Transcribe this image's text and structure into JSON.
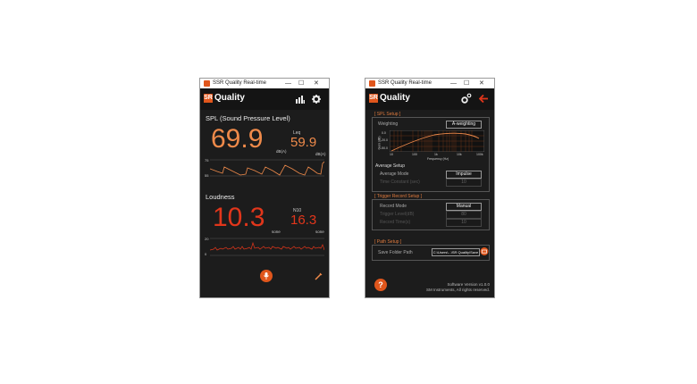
{
  "window_title": "SSR Quality Real-time",
  "logo": {
    "badge": "SR",
    "text": "Quality"
  },
  "left": {
    "spl_title": "SPL (Sound Pressure Level)",
    "spl_value": "69.9",
    "spl_unit": "dB(A)",
    "leq_label": "Leq",
    "leq_value": "59.9",
    "leq_unit": "dB(A)",
    "spl_axis_top": "75",
    "spl_axis_bottom": "55",
    "loudness_title": "Loudness",
    "loud_value": "10.3",
    "loud_unit": "sone",
    "n10_label": "N10",
    "n10_value": "16.3",
    "n10_unit": "sone",
    "loud_axis_top": "20",
    "loud_axis_bottom": "0"
  },
  "right": {
    "spl_setup": "[ SPL Setup ]",
    "weighting_label": "Weighting",
    "weighting_value": "A-weighting",
    "graph_ylabel": "Gain (dB)",
    "graph_xlabel": "Frequency (Hz)",
    "graph_yticks": [
      "0.0",
      "-20.0",
      "-50.0"
    ],
    "graph_xticks": [
      "10",
      "100",
      "1k",
      "10k",
      "100k"
    ],
    "average_setup": "Average Setup",
    "average_mode_label": "Average Mode",
    "average_mode_value": "Impulse",
    "time_constant_label": "Time Constant (sec)",
    "time_constant_value": "10",
    "trigger_setup": "[ Trigger Record Setup ]",
    "record_mode_label": "Record Mode",
    "record_mode_value": "Manual",
    "trigger_level_label": "Trigger Level(dB)",
    "trigger_level_value": "80",
    "record_time_label": "Record Time(s)",
    "record_time_value": "10",
    "path_setup": "[ Path Setup ]",
    "save_folder_label": "Save Folder Path",
    "save_folder_value": "C:\\Users\\...\\SR Quality\\Save Data",
    "version": "Software Version v1.0.0",
    "copyright": "SM Instruments, All rights reserved."
  },
  "colors": {
    "accent": "#ef8a4a",
    "red": "#e1361b",
    "bg": "#1c1c1c"
  },
  "icons": [
    "chart-icon",
    "gear-icon",
    "settings-gears-icon",
    "back-arrow-icon",
    "mic-icon",
    "pen-icon",
    "help-icon",
    "folder-icon"
  ]
}
